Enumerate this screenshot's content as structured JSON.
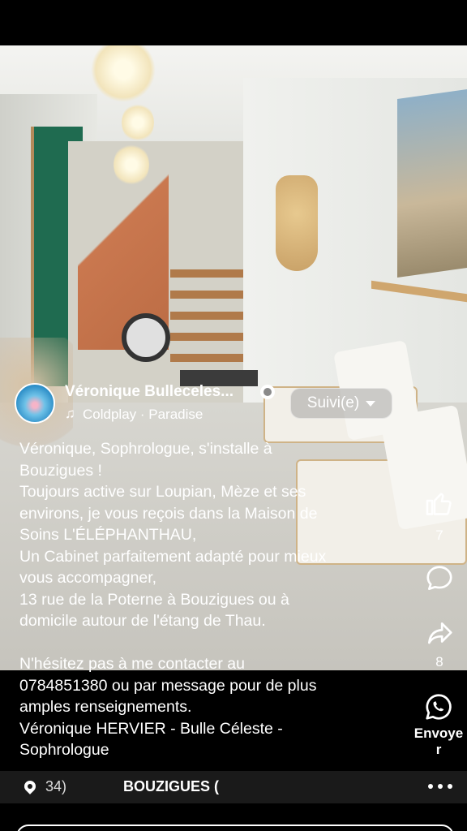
{
  "post": {
    "author": "Véronique Bulleceles...",
    "audio": "Coldplay · Paradise",
    "follow_label": "Suivi(e)",
    "caption_lines": [
      "Véronique,  Sophrologue, s'installe à",
      "Bouzigues !",
      "Toujours active sur Loupian, Mèze et ses",
      "environs, je vous reçois dans la Maison de",
      "Soins L'ÉLÉPHANTHAU,",
      "Un Cabinet parfaitement adapté pour mieux",
      "vous accompagner,",
      "13 rue de la Poterne à Bouzigues ou à",
      "domicile autour de l'étang de Thau.",
      "",
      "N'hésitez pas à me contacter  au",
      "0784851380 ou par message pour de plus",
      "amples renseignements.",
      "Véronique  HERVIER -  Bulle Céleste  -",
      "Sophrologue"
    ]
  },
  "actions": {
    "like_count": "7",
    "share_count": "8",
    "send_label_1": "Envoye",
    "send_label_2": "r"
  },
  "location": {
    "left_text": "34)",
    "main_text": "BOUZIGUES (",
    "pin_icon": "location-pin-icon",
    "more_icon": "more-options-icon"
  },
  "icons": {
    "globe": "globe-icon",
    "music": "music-note-icon",
    "like": "thumbs-up-icon",
    "comment": "comment-bubble-icon",
    "share": "share-arrow-icon",
    "send": "whatsapp-icon"
  },
  "colors": {
    "background": "#000000",
    "text": "#ffffff",
    "location_bar": "#1a1a1a"
  }
}
